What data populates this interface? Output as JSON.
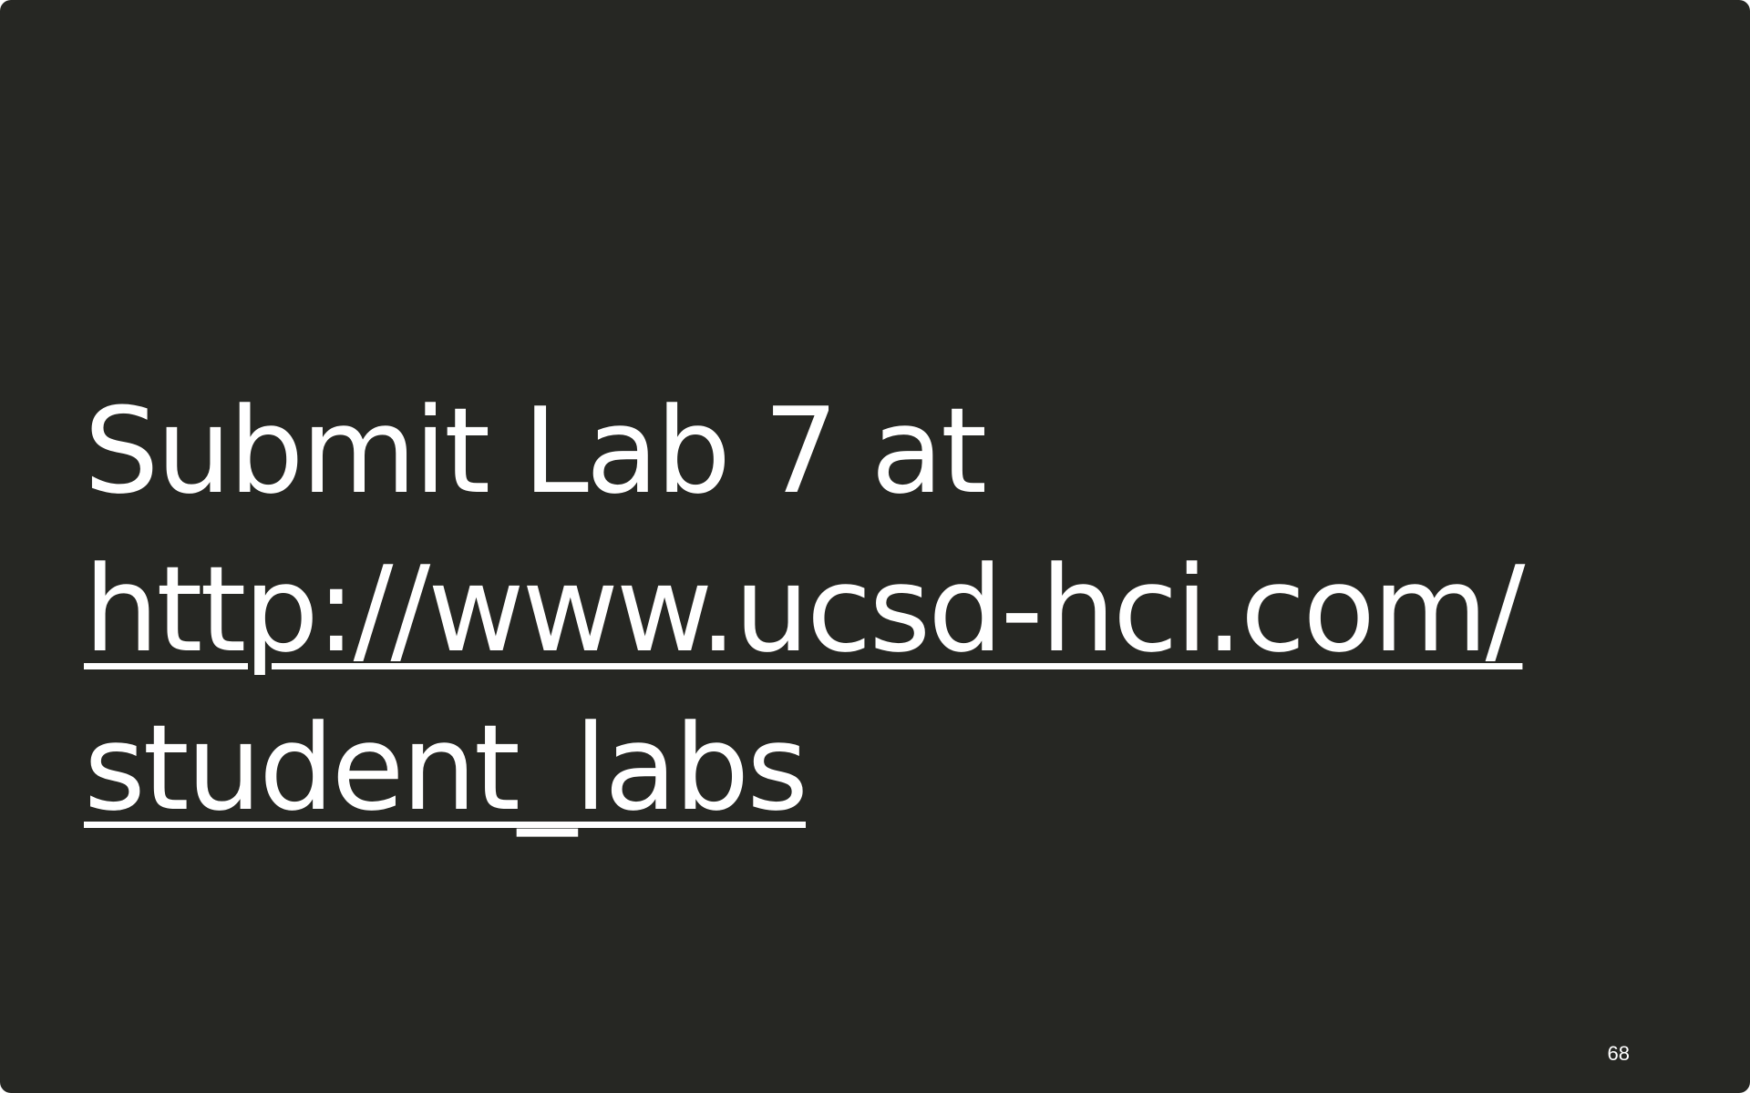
{
  "slide": {
    "heading_line": "Submit Lab 7 at",
    "link_line_1": "http://www.ucsd-hci.com/",
    "link_line_2": "student_labs",
    "page_number": "68"
  },
  "colors": {
    "background": "#262723",
    "text": "#ffffff"
  }
}
